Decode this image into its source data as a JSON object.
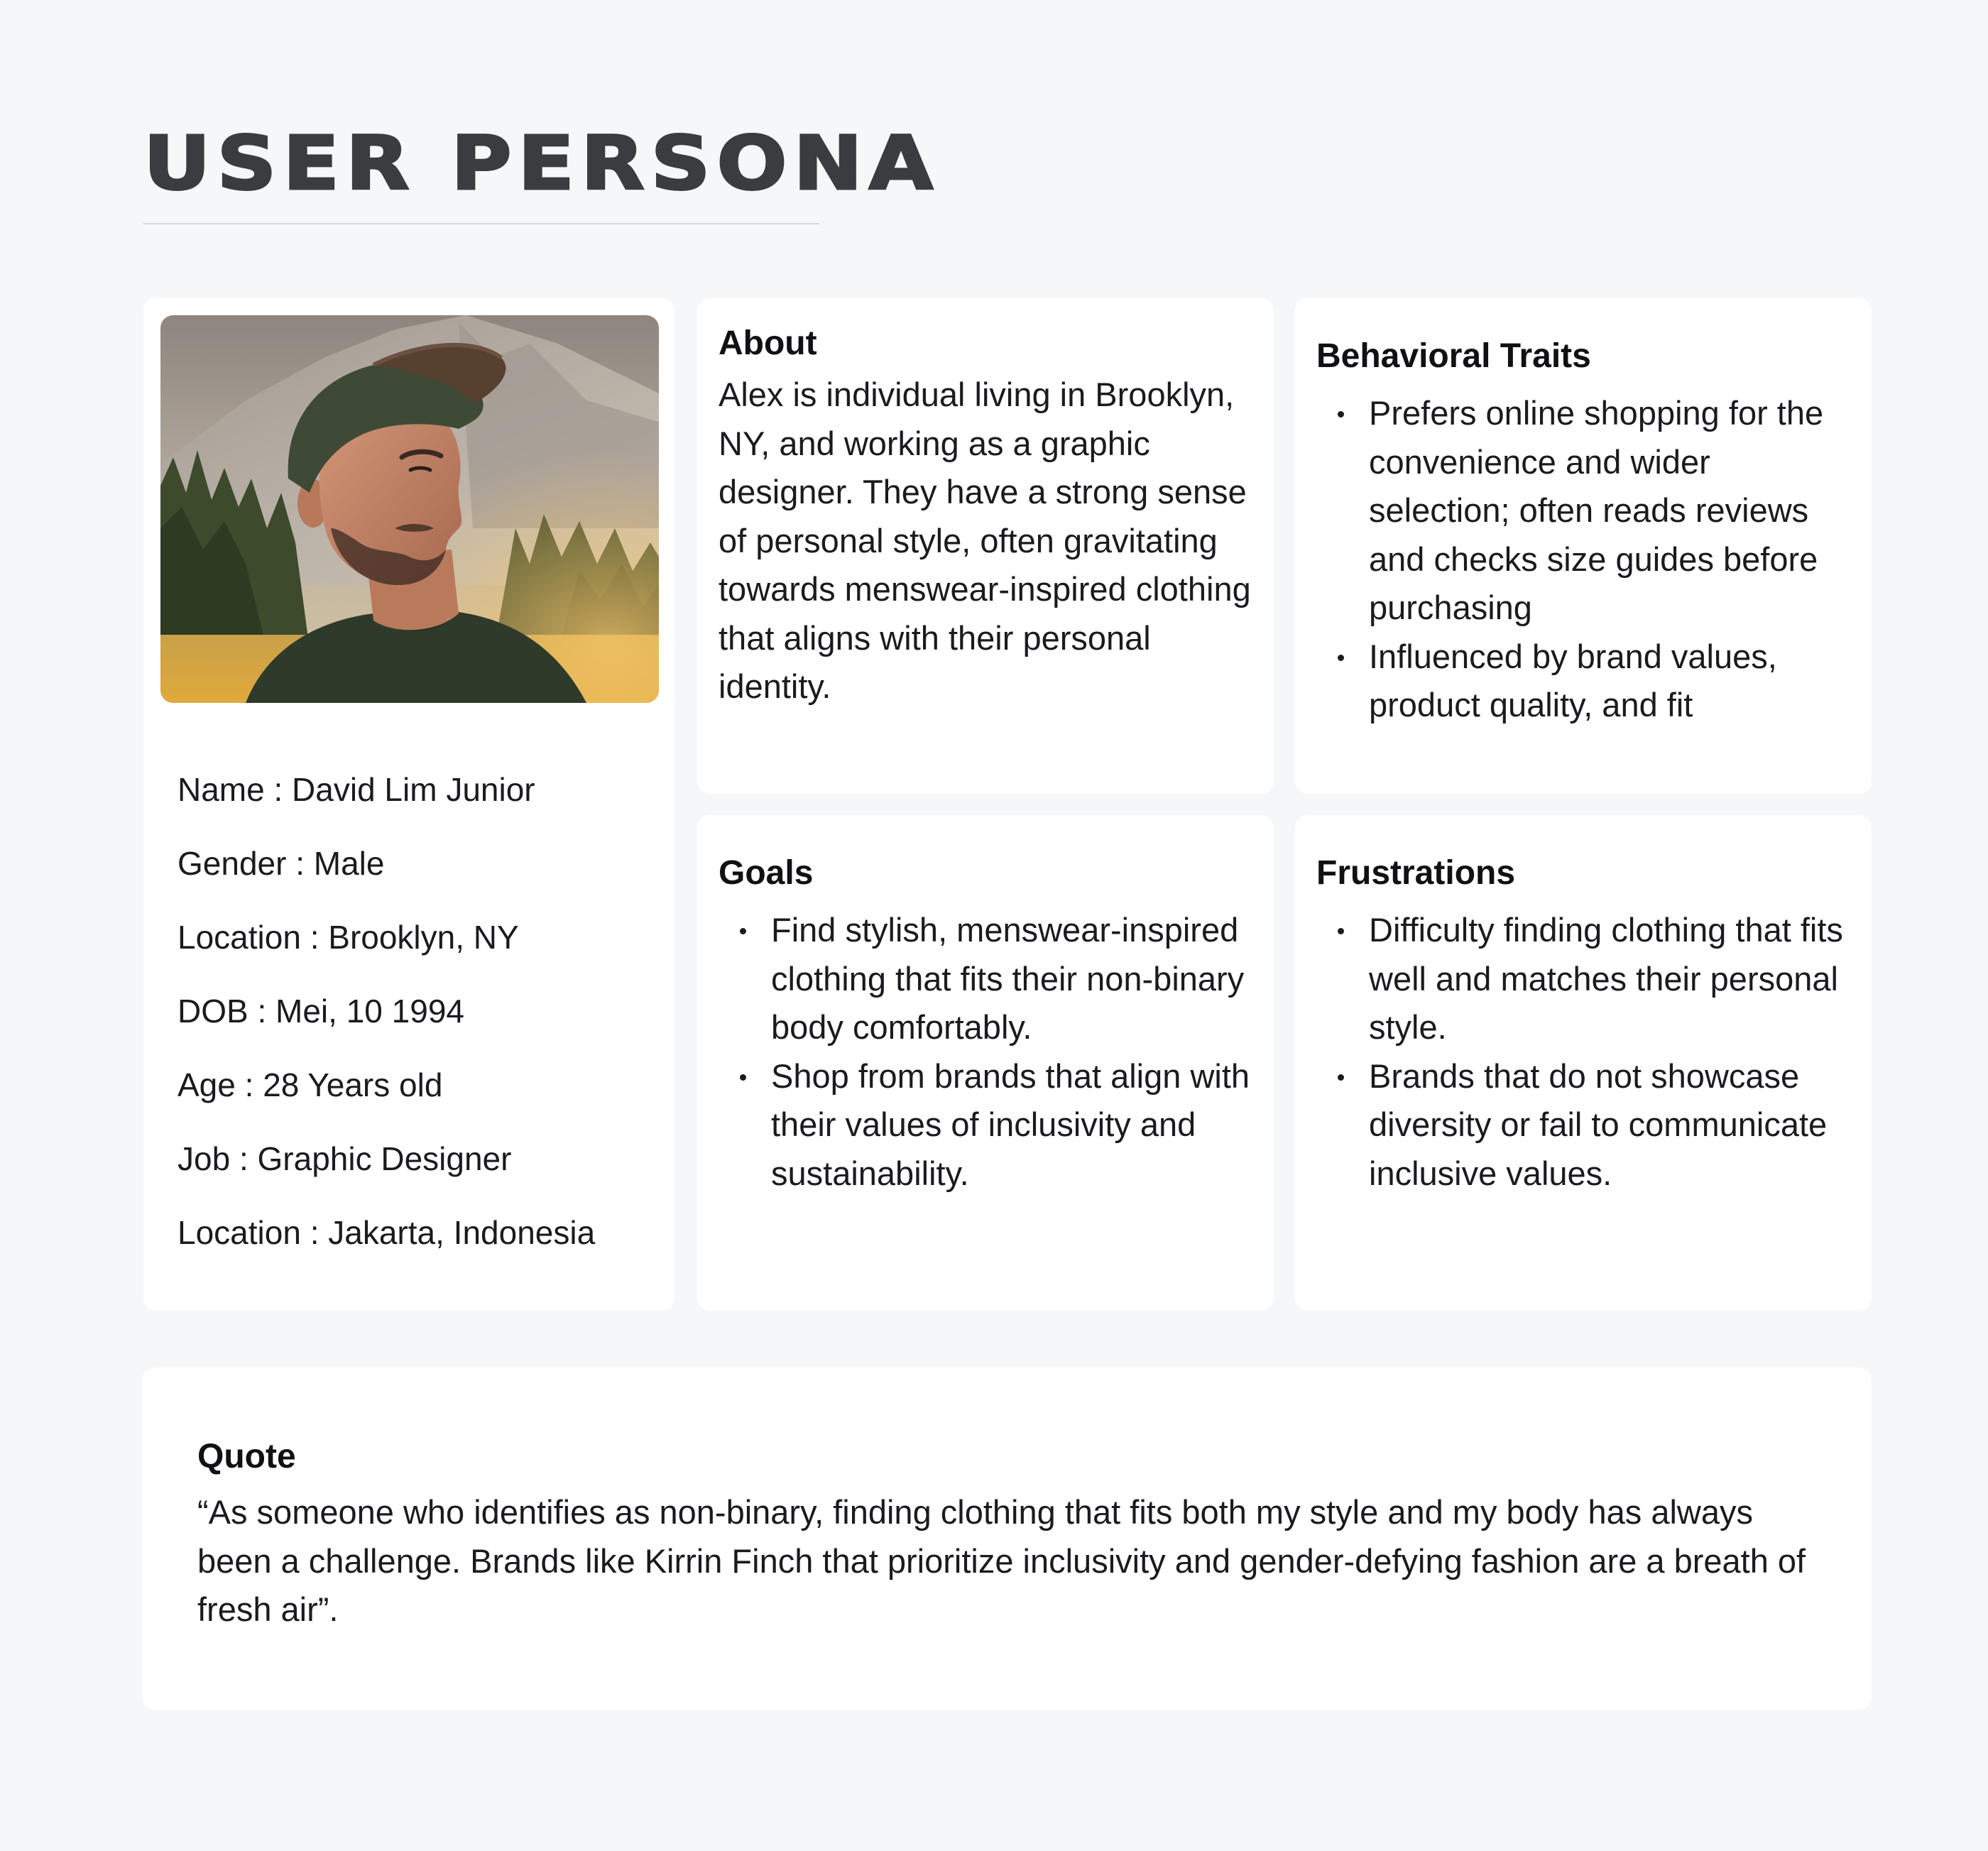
{
  "page": {
    "title": "USER PERSONA"
  },
  "profile": {
    "photo_alt": "Portrait of a man in a cap outdoors",
    "fields": [
      "Name : David Lim Junior",
      "Gender : Male",
      "Location : Brooklyn, NY",
      "DOB : Mei, 10 1994",
      "Age : 28 Years old",
      "Job : Graphic Designer",
      "Location : Jakarta, Indonesia"
    ]
  },
  "about": {
    "heading": "About",
    "text": "Alex is individual living in Brooklyn, NY, and working as a graphic designer. They have a strong sense of personal style, often gravitating towards menswear-inspired clothing that aligns with their personal identity."
  },
  "behavioral_traits": {
    "heading": "Behavioral Traits",
    "items": [
      "Prefers online shopping for the convenience and wider selection; often reads reviews and checks size guides before purchasing",
      "Influenced by brand values, product quality, and fit"
    ]
  },
  "goals": {
    "heading": "Goals",
    "items": [
      "Find stylish, menswear-inspired clothing that fits their non-binary body comfortably.",
      "Shop from brands that align with their values of inclusivity and sustainability."
    ]
  },
  "frustrations": {
    "heading": "Frustrations",
    "items": [
      "Difficulty finding clothing that fits well and matches their personal style.",
      "Brands that do not showcase diversity or fail to communicate inclusive values."
    ]
  },
  "quote": {
    "heading": "Quote",
    "text": "“As someone who identifies as non-binary, finding clothing that fits both my style and my body has always been a challenge. Brands like Kirrin Finch that prioritize inclusivity and gender-defying fashion are a breath of fresh air”."
  },
  "colors": {
    "background": "#f6f7f9",
    "card": "#ffffff",
    "title": "#3b3c40",
    "text": "#1b1b1f"
  }
}
